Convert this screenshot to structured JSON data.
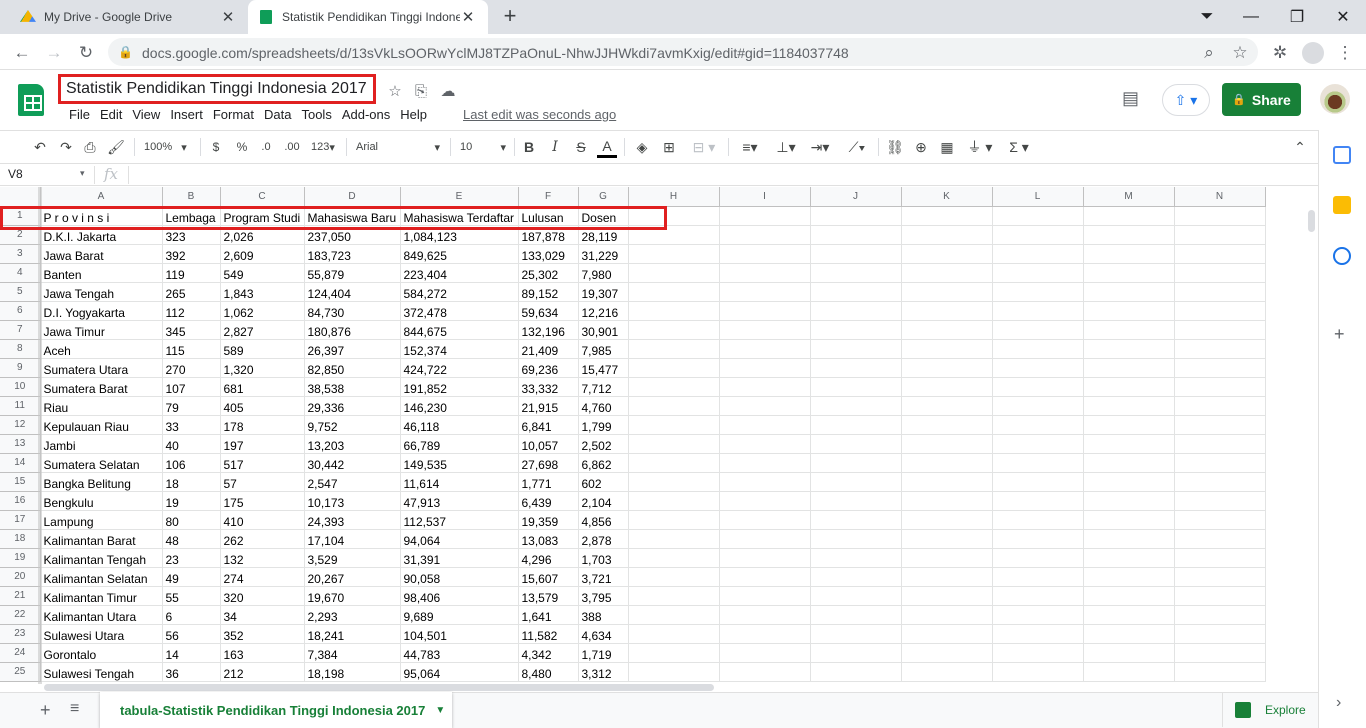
{
  "browser": {
    "tabs": [
      {
        "title": "My Drive - Google Drive",
        "active": false
      },
      {
        "title": "Statistik Pendidikan Tinggi Indonesia 2017",
        "active": true
      }
    ],
    "url": "docs.google.com/spreadsheets/d/13sVkLsOORwYclMJ8TZPaOnuL-NhwJJHWkdi7avmKxig/edit#gid=1184037748"
  },
  "doc": {
    "title": "Statistik Pendidikan Tinggi Indonesia 2017",
    "menus": [
      "File",
      "Edit",
      "View",
      "Insert",
      "Format",
      "Data",
      "Tools",
      "Add-ons",
      "Help"
    ],
    "last_edit": "Last edit was seconds ago",
    "share_label": "Share"
  },
  "toolbar": {
    "zoom": "100%",
    "currency": "$",
    "percent": "%",
    "dec_decrease": ".0",
    "dec_increase": ".00",
    "more_formats": "123",
    "font": "Arial",
    "font_size": "10"
  },
  "formula_bar": {
    "cell_ref": "V8",
    "fx": "fx",
    "value": ""
  },
  "grid": {
    "columns": [
      "A",
      "B",
      "C",
      "D",
      "E",
      "F",
      "G",
      "H",
      "I",
      "J",
      "K",
      "L",
      "M",
      "N"
    ],
    "header": [
      "P r o v i n s i",
      "Lembaga",
      "Program Studi",
      "Mahasiswa Baru",
      "Mahasiswa Terdaftar",
      "Lulusan",
      "Dosen"
    ],
    "rows": [
      [
        "D.K.I. Jakarta",
        "323",
        "2,026",
        "237,050",
        "1,084,123",
        "187,878",
        "28,119"
      ],
      [
        "Jawa Barat",
        "392",
        "2,609",
        "183,723",
        "849,625",
        "133,029",
        "31,229"
      ],
      [
        "Banten",
        "119",
        "549",
        "55,879",
        "223,404",
        "25,302",
        "7,980"
      ],
      [
        "Jawa Tengah",
        "265",
        "1,843",
        "124,404",
        "584,272",
        "89,152",
        "19,307"
      ],
      [
        "D.I. Yogyakarta",
        "112",
        "1,062",
        "84,730",
        "372,478",
        "59,634",
        "12,216"
      ],
      [
        "Jawa Timur",
        "345",
        "2,827",
        "180,876",
        "844,675",
        "132,196",
        "30,901"
      ],
      [
        "Aceh",
        "115",
        "589",
        "26,397",
        "152,374",
        "21,409",
        "7,985"
      ],
      [
        "Sumatera Utara",
        "270",
        "1,320",
        "82,850",
        "424,722",
        "69,236",
        "15,477"
      ],
      [
        "Sumatera Barat",
        "107",
        "681",
        "38,538",
        "191,852",
        "33,332",
        "7,712"
      ],
      [
        "Riau",
        "79",
        "405",
        "29,336",
        "146,230",
        "21,915",
        "4,760"
      ],
      [
        "Kepulauan Riau",
        "33",
        "178",
        "9,752",
        "46,118",
        "6,841",
        "1,799"
      ],
      [
        "Jambi",
        "40",
        "197",
        "13,203",
        "66,789",
        "10,057",
        "2,502"
      ],
      [
        "Sumatera Selatan",
        "106",
        "517",
        "30,442",
        "149,535",
        "27,698",
        "6,862"
      ],
      [
        "Bangka Belitung",
        "18",
        "57",
        "2,547",
        "11,614",
        "1,771",
        "602"
      ],
      [
        "Bengkulu",
        "19",
        "175",
        "10,173",
        "47,913",
        "6,439",
        "2,104"
      ],
      [
        "Lampung",
        "80",
        "410",
        "24,393",
        "112,537",
        "19,359",
        "4,856"
      ],
      [
        "Kalimantan Barat",
        "48",
        "262",
        "17,104",
        "94,064",
        "13,083",
        "2,878"
      ],
      [
        "Kalimantan Tengah",
        "23",
        "132",
        "3,529",
        "31,391",
        "4,296",
        "1,703"
      ],
      [
        "Kalimantan Selatan",
        "49",
        "274",
        "20,267",
        "90,058",
        "15,607",
        "3,721"
      ],
      [
        "Kalimantan Timur",
        "55",
        "320",
        "19,670",
        "98,406",
        "13,579",
        "3,795"
      ],
      [
        "Kalimantan Utara",
        "6",
        "34",
        "2,293",
        "9,689",
        "1,641",
        "388"
      ],
      [
        "Sulawesi Utara",
        "56",
        "352",
        "18,241",
        "104,501",
        "11,582",
        "4,634"
      ],
      [
        "Gorontalo",
        "14",
        "163",
        "7,384",
        "44,783",
        "4,342",
        "1,719"
      ],
      [
        "Sulawesi Tengah",
        "36",
        "212",
        "18,198",
        "95,064",
        "8,480",
        "3,312"
      ]
    ]
  },
  "sheet_tab": {
    "name": "tabula-Statistik Pendidikan Tinggi Indonesia 2017"
  },
  "explore_label": "Explore",
  "colors": {
    "accent_green": "#188038",
    "highlight_red": "#e02020",
    "tabstrip": "#dee1e6"
  }
}
